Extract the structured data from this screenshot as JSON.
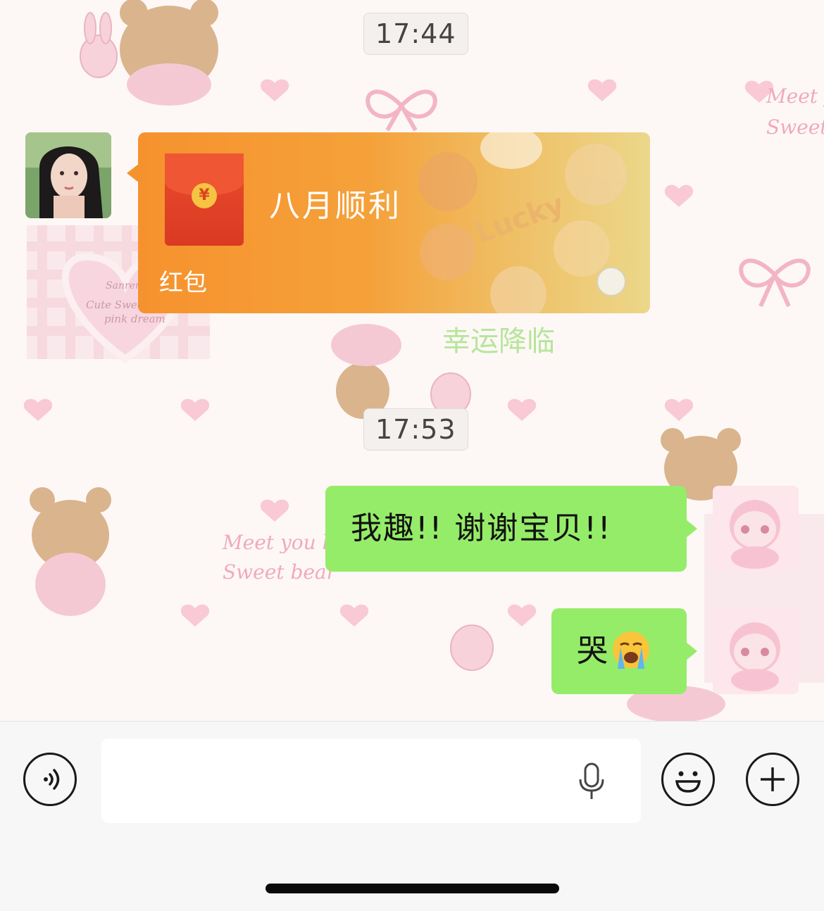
{
  "chat": {
    "timestamps": [
      "17:44",
      "17:53"
    ],
    "messages": [
      {
        "type": "red_packet",
        "sender": "contact",
        "title": "八月顺利",
        "footer": "红包"
      },
      {
        "type": "text",
        "sender": "me",
        "text": "我趣!! 谢谢宝贝!!"
      },
      {
        "type": "text",
        "sender": "me",
        "text": "哭"
      }
    ]
  },
  "red_packet": {
    "coin_symbol": "¥",
    "art_text": [
      "Lucky",
      "幸运降临"
    ]
  },
  "wallpaper_text": [
    "Meet you like",
    "Sweet bear",
    "Cute Sweet",
    "pink dream",
    "Meet y",
    "Sweet b",
    "Sanren"
  ],
  "emoji": {
    "crying": "loudly-crying-face"
  },
  "input_bar": {
    "voice_icon": "voice-waves-icon",
    "text_value": "",
    "mic_icon": "microphone-icon",
    "emoji_icon": "smiley-icon",
    "plus_icon": "plus-icon"
  },
  "colors": {
    "bubble_green": "#95ec69",
    "red_packet_orange": "#f6922e",
    "wallpaper_bg": "#fdf8f6",
    "accent_pink": "#f7c3d2"
  }
}
